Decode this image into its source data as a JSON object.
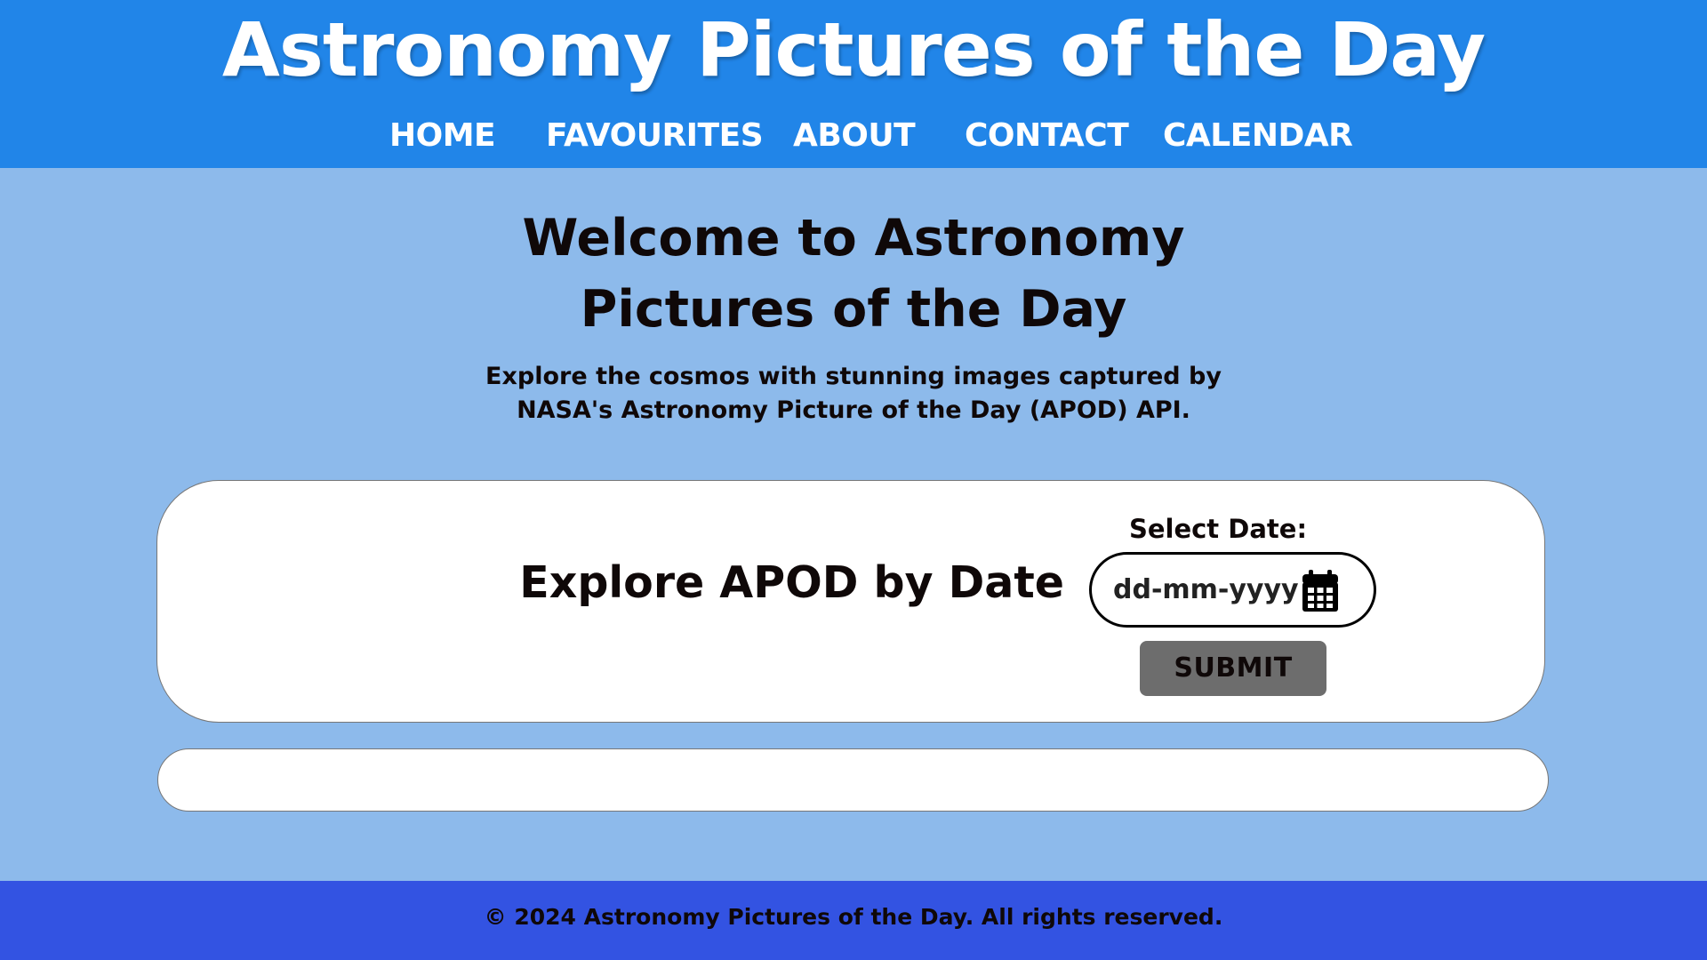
{
  "header": {
    "title": "Astronomy Pictures of the Day",
    "nav": [
      {
        "label": "HOME"
      },
      {
        "label": "FAVOURITES"
      },
      {
        "label": "ABOUT"
      },
      {
        "label": "CONTACT"
      },
      {
        "label": "CALENDAR"
      }
    ]
  },
  "welcome": {
    "title_line1": "Welcome to Astronomy",
    "title_line2": "Pictures of the Day",
    "subtitle_line1": "Explore the cosmos with stunning images captured by",
    "subtitle_line2": "NASA's Astronomy Picture of the Day (APOD) API."
  },
  "explore": {
    "title": "Explore APOD by Date",
    "date_label": "Select Date:",
    "date_placeholder": "dd-mm-yyyy",
    "date_icon": "calendar-icon",
    "submit_label": "SUBMIT"
  },
  "footer": {
    "text": "© 2024 Astronomy Pictures of the Day. All rights reserved."
  },
  "colors": {
    "header_bg": "#2185e8",
    "page_bg": "#8dbaeb",
    "card_bg": "#ffffff",
    "submit_bg": "#6d6d6d",
    "footer_bg": "#3353e2",
    "text_dark": "#0f0808"
  }
}
